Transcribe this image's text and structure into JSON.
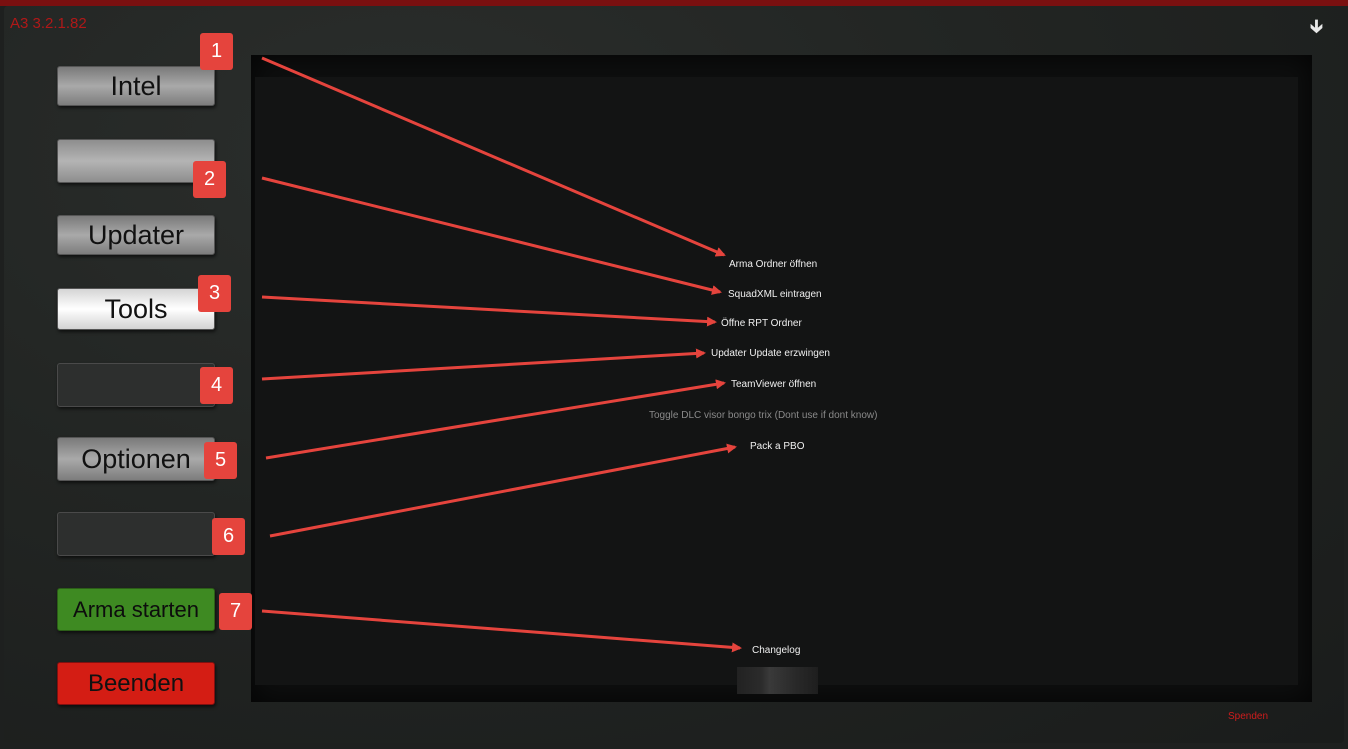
{
  "header": {
    "version": "A3 3.2.1.82",
    "download_icon": "arrow-down-icon"
  },
  "nav": [
    {
      "id": "intel",
      "label": "Intel"
    },
    {
      "id": "empty1",
      "label": ""
    },
    {
      "id": "updater",
      "label": "Updater"
    },
    {
      "id": "tools",
      "label": "Tools"
    },
    {
      "id": "empty2",
      "label": ""
    },
    {
      "id": "optionen",
      "label": "Optionen"
    },
    {
      "id": "empty3",
      "label": ""
    },
    {
      "id": "start",
      "label": "Arma starten"
    },
    {
      "id": "quit",
      "label": "Beenden"
    }
  ],
  "badges": [
    "1",
    "2",
    "3",
    "4",
    "5",
    "6",
    "7"
  ],
  "tools": {
    "open_arma": "Arma Ordner öffnen",
    "squadxml": "SquadXML eintragen",
    "open_rpt": "Öffne RPT Ordner",
    "force_update": "Updater Update erzwingen",
    "teamviewer": "TeamViewer öffnen",
    "toggle_dlc": "Toggle DLC visor bongo trix (Dont use if dont know)",
    "pack_pbo": "Pack a PBO",
    "changelog": "Changelog"
  },
  "footer": {
    "donate": "Spenden"
  },
  "colors": {
    "accent_red": "#e5443d",
    "start_green": "#3e8a22",
    "quit_red": "#d41d14"
  }
}
